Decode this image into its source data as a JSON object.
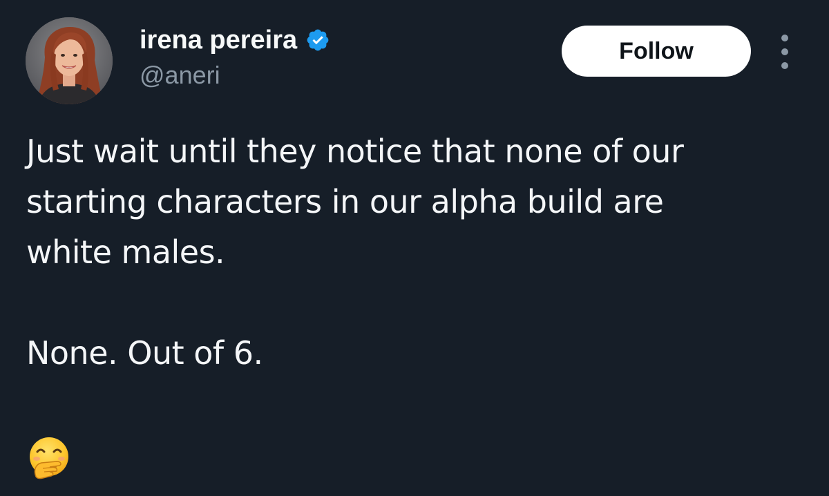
{
  "author": {
    "display_name": "irena pereira",
    "handle": "@aneri",
    "verified": true,
    "avatar_icon": "profile-photo"
  },
  "actions": {
    "follow_label": "Follow",
    "more_icon": "more-vertical-icon"
  },
  "tweet": {
    "lines": [
      "Just wait until they notice that none of our",
      "starting characters in our alpha build are",
      "white males.",
      "None. Out of 6."
    ],
    "emoji": "face-with-hand-over-mouth-emoji"
  },
  "colors": {
    "background": "#161e28",
    "text_primary": "#f4f6f8",
    "text_secondary": "#8b98a5",
    "verified_blue": "#1d9bf0",
    "follow_bg": "#ffffff",
    "follow_text": "#0f1419"
  }
}
